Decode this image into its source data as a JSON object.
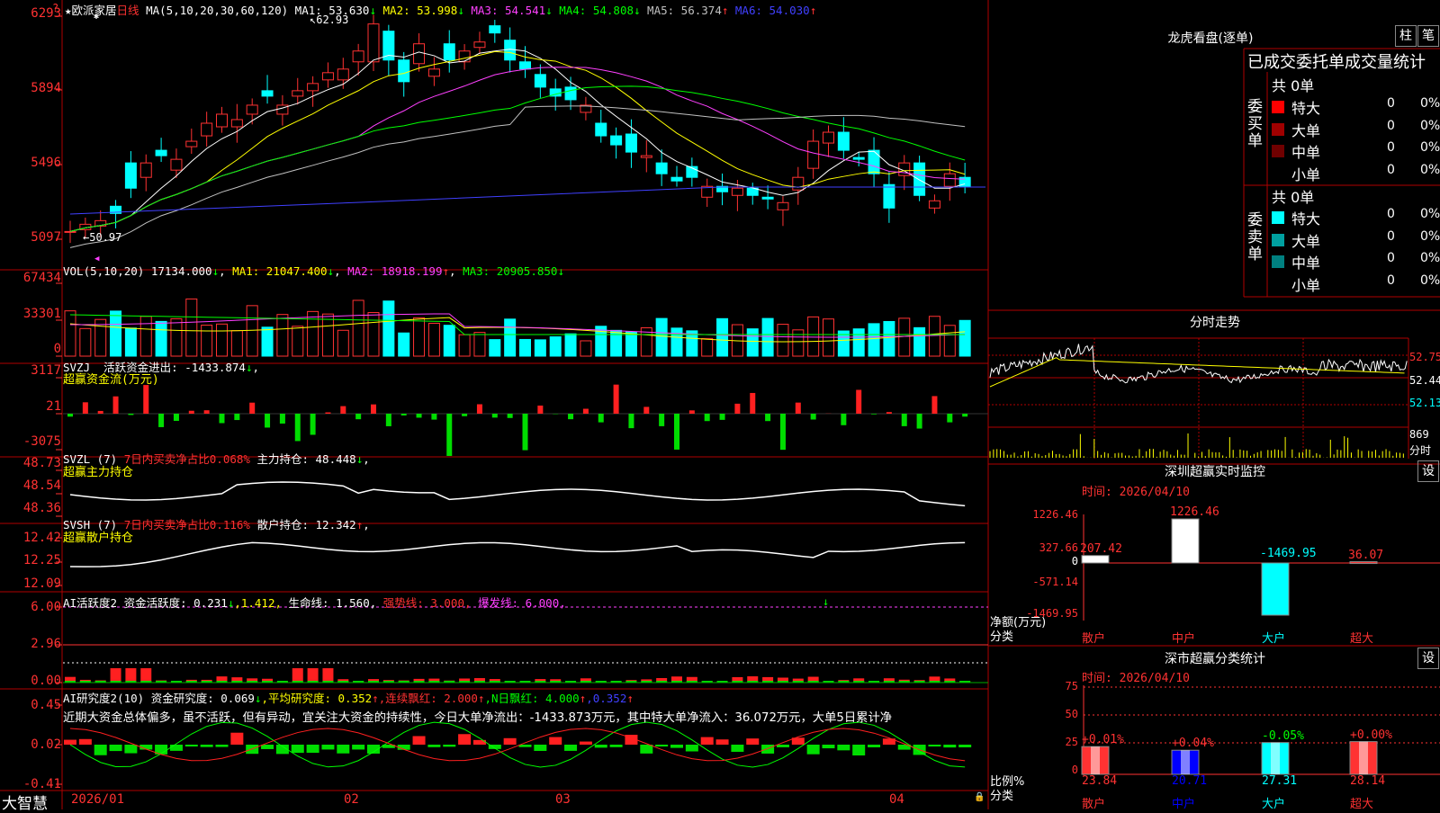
{
  "stock": {
    "name": "欧派家居",
    "period": "日线",
    "star": "★"
  },
  "main": {
    "ma_label": "MA(5,10,20,30,60,120)",
    "ma": [
      {
        "label": "MA1: 53.630",
        "arrow": "↓",
        "color": "#ffffff"
      },
      {
        "label": "MA2: 53.998",
        "arrow": "↓",
        "color": "#ffff00"
      },
      {
        "label": "MA3: 54.541",
        "arrow": "↓",
        "color": "#ff40ff"
      },
      {
        "label": "MA4: 54.808",
        "arrow": "↓",
        "color": "#00ff00"
      },
      {
        "label": "MA5: 56.374",
        "arrow": "↑",
        "color": "#c0c0c0"
      },
      {
        "label": "MA6: 54.030",
        "arrow": "↑",
        "color": "#4040ff"
      }
    ],
    "yticks": [
      "6293",
      "5894",
      "5496",
      "5097"
    ],
    "high_label": "62.93",
    "low_label": "←50.97"
  },
  "vol": {
    "label": "VOL(5,10,20)",
    "value": "17134.000",
    "v_arrow": "↓",
    "ma1": "MA1: 21047.400",
    "ma1_arrow": "↓",
    "ma2": "MA2: 18918.199",
    "ma2_arrow": "↑",
    "ma3": "MA3: 20905.850",
    "ma3_arrow": "↓",
    "yticks": [
      "67434",
      "33301",
      "0"
    ]
  },
  "svzj": {
    "line1_a": "SVZJ",
    "line1_b": "活跃资金进出: -1433.874",
    "line1_arrow": "↓",
    "line1_c": ",",
    "line2": "超赢资金流(万元)",
    "yticks": [
      "3117",
      "21",
      "-3075"
    ]
  },
  "svzl": {
    "a": "SVZL (7)",
    "b": "7日内买卖净占比0.068%",
    "c": "主力持仓: 48.448",
    "arrow": "↓",
    "d": ",",
    "line2": "超赢主力持仓",
    "yticks": [
      "48.73",
      "48.54",
      "48.36"
    ]
  },
  "svsh": {
    "a": "SVSH (7)",
    "b": "7日内买卖净占比0.116%",
    "c": "散户持仓: 12.342",
    "arrow": "↑",
    "d": ",",
    "line2": "超赢散户持仓",
    "yticks": [
      "12.42",
      "12.25",
      "12.09"
    ]
  },
  "ai1": {
    "a": "AI活跃度2",
    "b": "资金活跃度: 0.231",
    "arrow1": "↓",
    "c": ",1.412,",
    "d": "生命线: 1.560,",
    "e": "强势线: 3.000,",
    "f": "爆发线: 6.000,",
    "yticks": [
      "6.00",
      "2.96",
      "0.00"
    ]
  },
  "ai2": {
    "a": "AI研究度2(10)",
    "b": "资金研究度: 0.069",
    "arrow1": "↓",
    "c": ",平均研究度: 0.352",
    "arrow2": "↑",
    "d": ",连续飘红: 2.000",
    "arrow3": "↑",
    "e": ",N日飘红: 4.000",
    "arrow4": "↑",
    "f": ",0.352",
    "arrow5": "↑",
    "comment": "近期大资金总体偏多，虽不活跃，但有异动，宜关注大资金的持续性，今日大单净流出：-1433.873万元，其中特大单净流入：36.072万元，大单5日累计净",
    "yticks": [
      "0.45",
      "0.02",
      "-0.41"
    ]
  },
  "xaxis": {
    "logo": "大智慧",
    "labels": [
      "2026/01",
      "02",
      "03",
      "04"
    ]
  },
  "right": {
    "dragon": {
      "title": "龙虎看盘(逐单)",
      "btn1": "柱",
      "btn2": "笔",
      "subtitle": "已成交委托单成交量统计",
      "buy": {
        "side": "委买单",
        "total": "共 0单",
        "rows": [
          {
            "name": "特大",
            "v": "0",
            "p": "0%",
            "color": "#ff0000"
          },
          {
            "name": "大单",
            "v": "0",
            "p": "0%",
            "color": "#a00000"
          },
          {
            "name": "中单",
            "v": "0",
            "p": "0%",
            "color": "#700000"
          },
          {
            "name": "小单",
            "v": "0",
            "p": "0%",
            "color": "#000000"
          }
        ]
      },
      "sell": {
        "side": "委卖单",
        "total": "共 0单",
        "rows": [
          {
            "name": "特大",
            "v": "0",
            "p": "0%",
            "color": "#00ffff"
          },
          {
            "name": "大单",
            "v": "0",
            "p": "0%",
            "color": "#00a0a0"
          },
          {
            "name": "中单",
            "v": "0",
            "p": "0%",
            "color": "#008080"
          },
          {
            "name": "小单",
            "v": "0",
            "p": "0%",
            "color": "#000000"
          }
        ]
      }
    },
    "minute": {
      "title": "分时走势",
      "ylabels": [
        "52.75",
        "52.44",
        "52.13"
      ],
      "vol_label": "869",
      "vol_unit": "分时"
    },
    "monitor": {
      "title": "深圳超赢实时监控",
      "btn": "设",
      "time": "时间: 2026/04/10",
      "yticks": [
        "1226.46",
        "327.66",
        "0",
        "-571.14",
        "-1469.95"
      ],
      "ylabel": "净额(万元)",
      "xlabel": "分类",
      "chart_data": {
        "type": "bar",
        "categories": [
          "散户",
          "中户",
          "大户",
          "超大"
        ],
        "values": [
          207.42,
          1226.46,
          -1469.95,
          36.07
        ],
        "value_labels": [
          "207.42",
          "1226.46",
          "-1469.95",
          "36.07"
        ],
        "ylim": [
          -1469.95,
          1226.46
        ]
      }
    },
    "classify": {
      "title": "深市超赢分类统计",
      "btn": "设",
      "time": "时间: 2026/04/10",
      "yticks": [
        "75",
        "50",
        "25",
        "0"
      ],
      "ylabel": "比例%",
      "xlabel": "分类",
      "chart_data": {
        "type": "bar",
        "categories": [
          "散户",
          "中户",
          "大户",
          "超大"
        ],
        "values": [
          23.84,
          20.71,
          27.31,
          28.14
        ],
        "changes": [
          "+0.01%",
          "+0.04%",
          "-0.05%",
          "+0.00%"
        ],
        "value_labels": [
          "23.84",
          "20.71",
          "27.31",
          "28.14"
        ],
        "ylim": [
          0,
          75
        ],
        "colors": [
          "#ff3232",
          "#0000ff",
          "#00ffff",
          "#ff3232"
        ]
      }
    }
  }
}
